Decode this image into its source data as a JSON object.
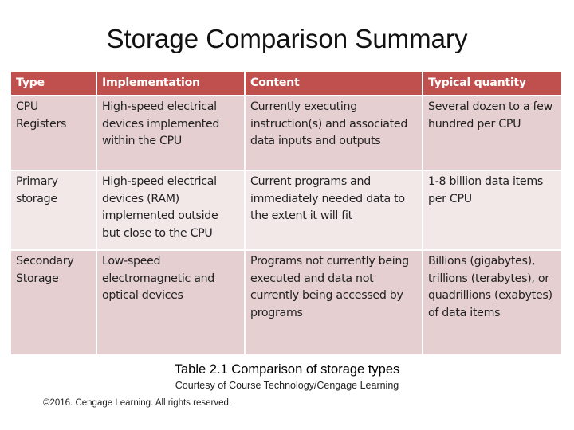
{
  "title": "Storage Comparison Summary",
  "table": {
    "headers": [
      "Type",
      "Implementation",
      "Content",
      "Typical quantity"
    ],
    "header_color": "#c0504d",
    "rows": [
      {
        "type": "CPU Registers",
        "implementation": "High-speed electrical devices implemented within the CPU",
        "content": "Currently executing instruction(s) and associated data inputs and outputs",
        "quantity": "Several dozen to a few hundred per CPU"
      },
      {
        "type": "Primary storage",
        "implementation": "High-speed electrical devices (RAM) implemented outside but close to the CPU",
        "content": "Current programs and immediately needed data to the extent it will fit",
        "quantity": "1-8 billion data items per CPU"
      },
      {
        "type": "Secondary Storage",
        "implementation": "Low-speed electromagnetic and optical devices",
        "content": "Programs not currently being executed and data not currently being accessed by programs",
        "quantity": "Billions (gigabytes), trillions (terabytes), or quadrillions (exabytes) of data items"
      }
    ]
  },
  "caption": "Table 2.1 Comparison of storage types",
  "courtesy": "Courtesy of Course Technology/Cengage Learning",
  "copyright": "©2016. Cengage Learning. All rights reserved."
}
